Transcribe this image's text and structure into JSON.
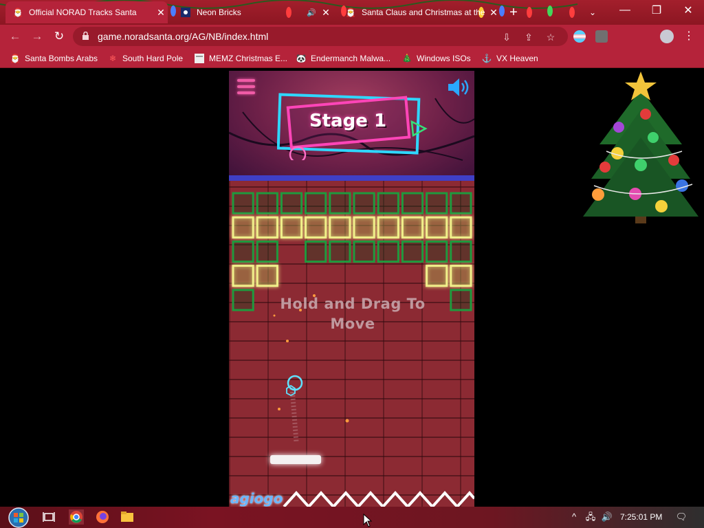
{
  "browser": {
    "tabs": [
      {
        "title": "Official NORAD Tracks Santa",
        "active": true
      },
      {
        "title": "Neon Bricks",
        "active": false,
        "audio": true
      },
      {
        "title": "Santa Claus and Christmas at the",
        "active": false
      }
    ],
    "url": "game.noradsanta.org/AG/NB/index.html",
    "bookmarks": [
      {
        "label": "Santa Bombs Arabs",
        "icon": "santa-icon"
      },
      {
        "label": "South Hard Pole",
        "icon": "snowflake-icon"
      },
      {
        "label": "MEMZ Christmas E...",
        "icon": "page-icon"
      },
      {
        "label": "Endermanch Malwa...",
        "icon": "panda-icon"
      },
      {
        "label": "Windows ISOs",
        "icon": "tree-icon"
      },
      {
        "label": "VX Heaven",
        "icon": "ship-icon"
      }
    ],
    "colors": {
      "frame": "#b5233a",
      "tabstrip": "#8c1622"
    }
  },
  "game": {
    "stage_label": "Stage 1",
    "hint": "Hold and Drag To Move",
    "logo": "agiogo",
    "colors": {
      "green_brick": "#1f9a3e",
      "yellow_brick": "#f0f08a",
      "paddle": "#f4f1f1",
      "ball": "#5fe3ff"
    }
  },
  "taskbar": {
    "clock": "7:25:01 PM"
  }
}
